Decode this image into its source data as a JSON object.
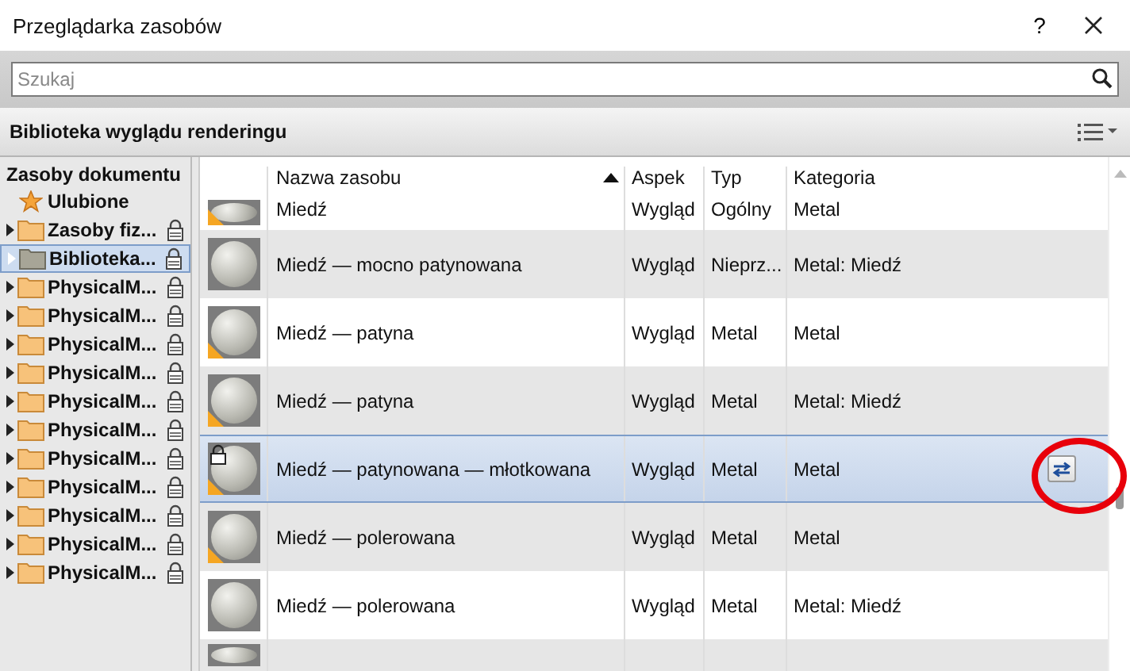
{
  "window": {
    "title": "Przeglądarka zasobów",
    "help": "?"
  },
  "search": {
    "placeholder": "Szukaj"
  },
  "library": {
    "title": "Biblioteka wyglądu renderingu"
  },
  "sidebar": {
    "heading": "Zasoby dokumentu",
    "favorites": "Ulubione",
    "items": [
      {
        "label": "Zasoby fiz...",
        "selected": false
      },
      {
        "label": "Biblioteka...",
        "selected": true
      },
      {
        "label": "PhysicalM...",
        "selected": false
      },
      {
        "label": "PhysicalM...",
        "selected": false
      },
      {
        "label": "PhysicalM...",
        "selected": false
      },
      {
        "label": "PhysicalM...",
        "selected": false
      },
      {
        "label": "PhysicalM...",
        "selected": false
      },
      {
        "label": "PhysicalM...",
        "selected": false
      },
      {
        "label": "PhysicalM...",
        "selected": false
      },
      {
        "label": "PhysicalM...",
        "selected": false
      },
      {
        "label": "PhysicalM...",
        "selected": false
      },
      {
        "label": "PhysicalM...",
        "selected": false
      },
      {
        "label": "PhysicalM...",
        "selected": false
      }
    ]
  },
  "table": {
    "columns": [
      "Nazwa zasobu",
      "Aspek",
      "Typ",
      "Kategoria"
    ],
    "rows": [
      {
        "kind": "partial",
        "name": "Miedź",
        "aspect": "Wygląd",
        "type": "Ogólny",
        "category": "Metal",
        "selected": false,
        "warning": true,
        "locked": false
      },
      {
        "kind": "full",
        "name": "Miedź — mocno patynowana",
        "aspect": "Wygląd",
        "type": "Nieprz...",
        "category": "Metal: Miedź",
        "selected": false,
        "warning": false,
        "locked": false
      },
      {
        "kind": "full",
        "name": "Miedź — patyna",
        "aspect": "Wygląd",
        "type": "Metal",
        "category": "Metal",
        "selected": false,
        "warning": true,
        "locked": false
      },
      {
        "kind": "full",
        "name": "Miedź — patyna",
        "aspect": "Wygląd",
        "type": "Metal",
        "category": "Metal: Miedź",
        "selected": false,
        "warning": true,
        "locked": false
      },
      {
        "kind": "full",
        "name": "Miedź — patynowana — młotkowana",
        "aspect": "Wygląd",
        "type": "Metal",
        "category": "Metal",
        "selected": true,
        "warning": true,
        "locked": true
      },
      {
        "kind": "full",
        "name": "Miedź — polerowana",
        "aspect": "Wygląd",
        "type": "Metal",
        "category": "Metal",
        "selected": false,
        "warning": true,
        "locked": false
      },
      {
        "kind": "full",
        "name": "Miedź — polerowana",
        "aspect": "Wygląd",
        "type": "Metal",
        "category": "Metal: Miedź",
        "selected": false,
        "warning": false,
        "locked": false
      },
      {
        "kind": "stub",
        "selected": false
      }
    ]
  }
}
